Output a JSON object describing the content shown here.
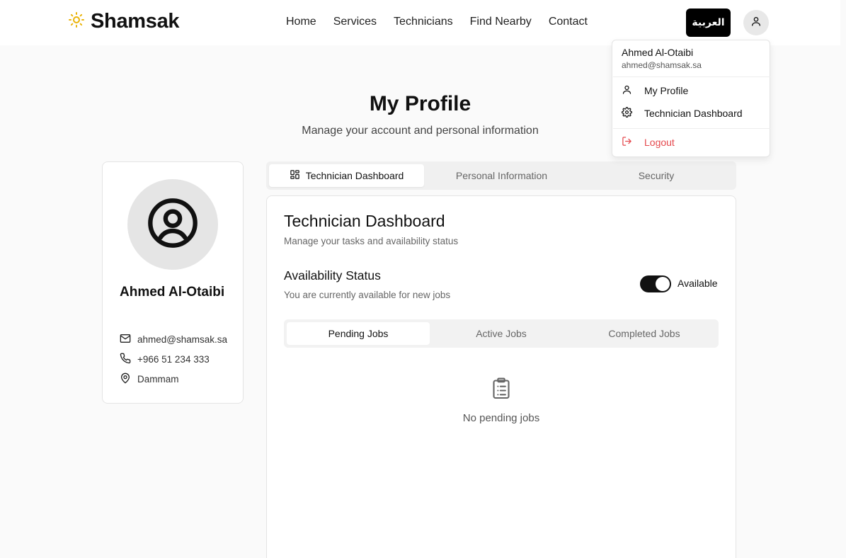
{
  "nav": {
    "brand": "Shamsak",
    "links": [
      "Home",
      "Services",
      "Technicians",
      "Find Nearby",
      "Contact"
    ],
    "language_button": "العربية",
    "accent_color": "#eab308"
  },
  "header": {
    "title": "My Profile",
    "subtitle": "Manage your account and personal information"
  },
  "profile": {
    "name": "Ahmed Al-Otaibi",
    "email": "ahmed@shamsak.sa",
    "phone": "+966 51 234 333",
    "city": "Dammam"
  },
  "tabs": [
    "Technician Dashboard",
    "Personal Information",
    "Security"
  ],
  "active_tab": "Technician Dashboard",
  "dashboard": {
    "title": "Technician Dashboard",
    "subtitle": "Manage your tasks and availability status",
    "availability_title": "Availability Status",
    "availability_subtitle": "You are currently available for new jobs",
    "availability_label": "Available",
    "available": true,
    "job_tabs": [
      "Pending Jobs",
      "Active Jobs",
      "Completed Jobs"
    ],
    "active_job_tab": "Pending Jobs",
    "empty_text": "No pending jobs"
  },
  "user_menu": {
    "name": "Ahmed Al-Otaibi",
    "email": "ahmed@shamsak.sa",
    "items": [
      "My Profile",
      "Technician Dashboard"
    ],
    "logout": "Logout",
    "logout_color": "#e5484d"
  }
}
